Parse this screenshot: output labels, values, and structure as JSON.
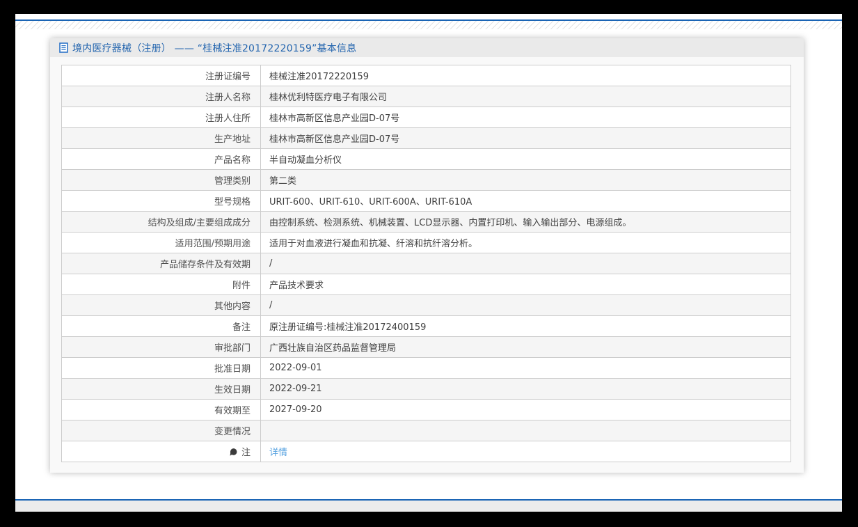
{
  "header": {
    "title": "境内医疗器械（注册） —— “桂械注准20172220159”基本信息",
    "icon": "document-icon"
  },
  "table": {
    "rows": [
      {
        "label": "注册证编号",
        "value": "桂械注准20172220159"
      },
      {
        "label": "注册人名称",
        "value": "桂林优利特医疗电子有限公司"
      },
      {
        "label": "注册人住所",
        "value": "桂林市高新区信息产业园D-07号"
      },
      {
        "label": "生产地址",
        "value": "桂林市高新区信息产业园D-07号"
      },
      {
        "label": "产品名称",
        "value": "半自动凝血分析仪"
      },
      {
        "label": "管理类别",
        "value": "第二类"
      },
      {
        "label": "型号规格",
        "value": "URIT-600、URIT-610、URIT-600A、URIT-610A"
      },
      {
        "label": "结构及组成/主要组成成分",
        "value": "由控制系统、检测系统、机械装置、LCD显示器、内置打印机、输入输出部分、电源组成。"
      },
      {
        "label": "适用范围/预期用途",
        "value": "适用于对血液进行凝血和抗凝、纤溶和抗纤溶分析。"
      },
      {
        "label": "产品储存条件及有效期",
        "value": "/"
      },
      {
        "label": "附件",
        "value": "产品技术要求"
      },
      {
        "label": "其他内容",
        "value": "/"
      },
      {
        "label": "备注",
        "value": "原注册证编号:桂械注准20172400159"
      },
      {
        "label": "审批部门",
        "value": "广西壮族自治区药品监督管理局"
      },
      {
        "label": "批准日期",
        "value": "2022-09-01"
      },
      {
        "label": "生效日期",
        "value": "2022-09-21"
      },
      {
        "label": "有效期至",
        "value": "2027-09-20"
      },
      {
        "label": "变更情况",
        "value": ""
      },
      {
        "label": "注",
        "value": "详情",
        "icon": "note-balloon-icon",
        "link": true
      }
    ]
  },
  "colors": {
    "accent_blue": "#1b65b5",
    "title_blue": "#2264ae",
    "link_blue": "#55a1e0",
    "zebra_gray": "#f5f5f5",
    "titlebar_gray": "#eaeaea",
    "footer_gray": "#ececec"
  }
}
